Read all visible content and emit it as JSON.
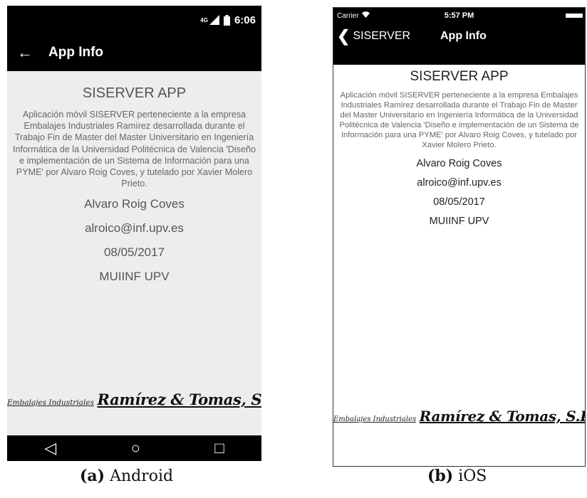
{
  "android": {
    "status_bar": {
      "network": "4G",
      "time": "6:06"
    },
    "app_bar": {
      "back_glyph": "←",
      "title": "App Info"
    },
    "content": {
      "app_name": "SISERVER APP",
      "description": "Aplicación móvil SISERVER perteneciente a la empresa Embalajes Industriales Ramírez desarrollada durante el Trabajo Fin de Master del Master Universitario en Ingeniería Informática de la Universidad Politécnica de Valencia 'Diseño e implementación de un Sistema de Información para una PYME' por Alvaro Roig Coves, y tutelado por Xavier Molero Prieto.",
      "author": "Alvaro Roig Coves",
      "email": "alroico@inf.upv.es",
      "date": "08/05/2017",
      "institution": "MUIINF UPV"
    },
    "logo": {
      "small_text": "Embalajes Industriales",
      "big_text": "Ramírez & Tomas, S.L."
    },
    "nav_bar": {
      "back": "◁",
      "home": "○",
      "recents": "□"
    }
  },
  "ios": {
    "status_bar": {
      "carrier": "Carrier",
      "time": "5:57 PM"
    },
    "nav_bar": {
      "back_label": "SISERVER",
      "title": "App Info"
    },
    "content": {
      "app_name": "SISERVER APP",
      "description": "Aplicación móvil SISERVER perteneciente a la empresa Embalajes Industriales Ramírez desarrollada durante el Trabajo Fin de Master del Master Universitario en Ingeniería Informática de la Universidad Politécnica de Valencia 'Diseño e implementación de un Sistema de Información para una PYME' por Alvaro Roig Coves, y tutelado por Xavier Molero Prieto.",
      "author": "Alvaro Roig Coves",
      "email": "alroico@inf.upv.es",
      "date": "08/05/2017",
      "institution": "MUIINF UPV"
    },
    "logo": {
      "small_text": "Embalajes Industriales",
      "big_text": "Ramírez & Tomas, S.L."
    }
  },
  "captions": {
    "a": {
      "label": "(a)",
      "text": "Android"
    },
    "b": {
      "label": "(b)",
      "text": "iOS"
    }
  },
  "icons": {
    "android_status": [
      "signal-icon",
      "battery-icon"
    ],
    "ios_status": [
      "wifi-icon",
      "battery-icon"
    ]
  }
}
